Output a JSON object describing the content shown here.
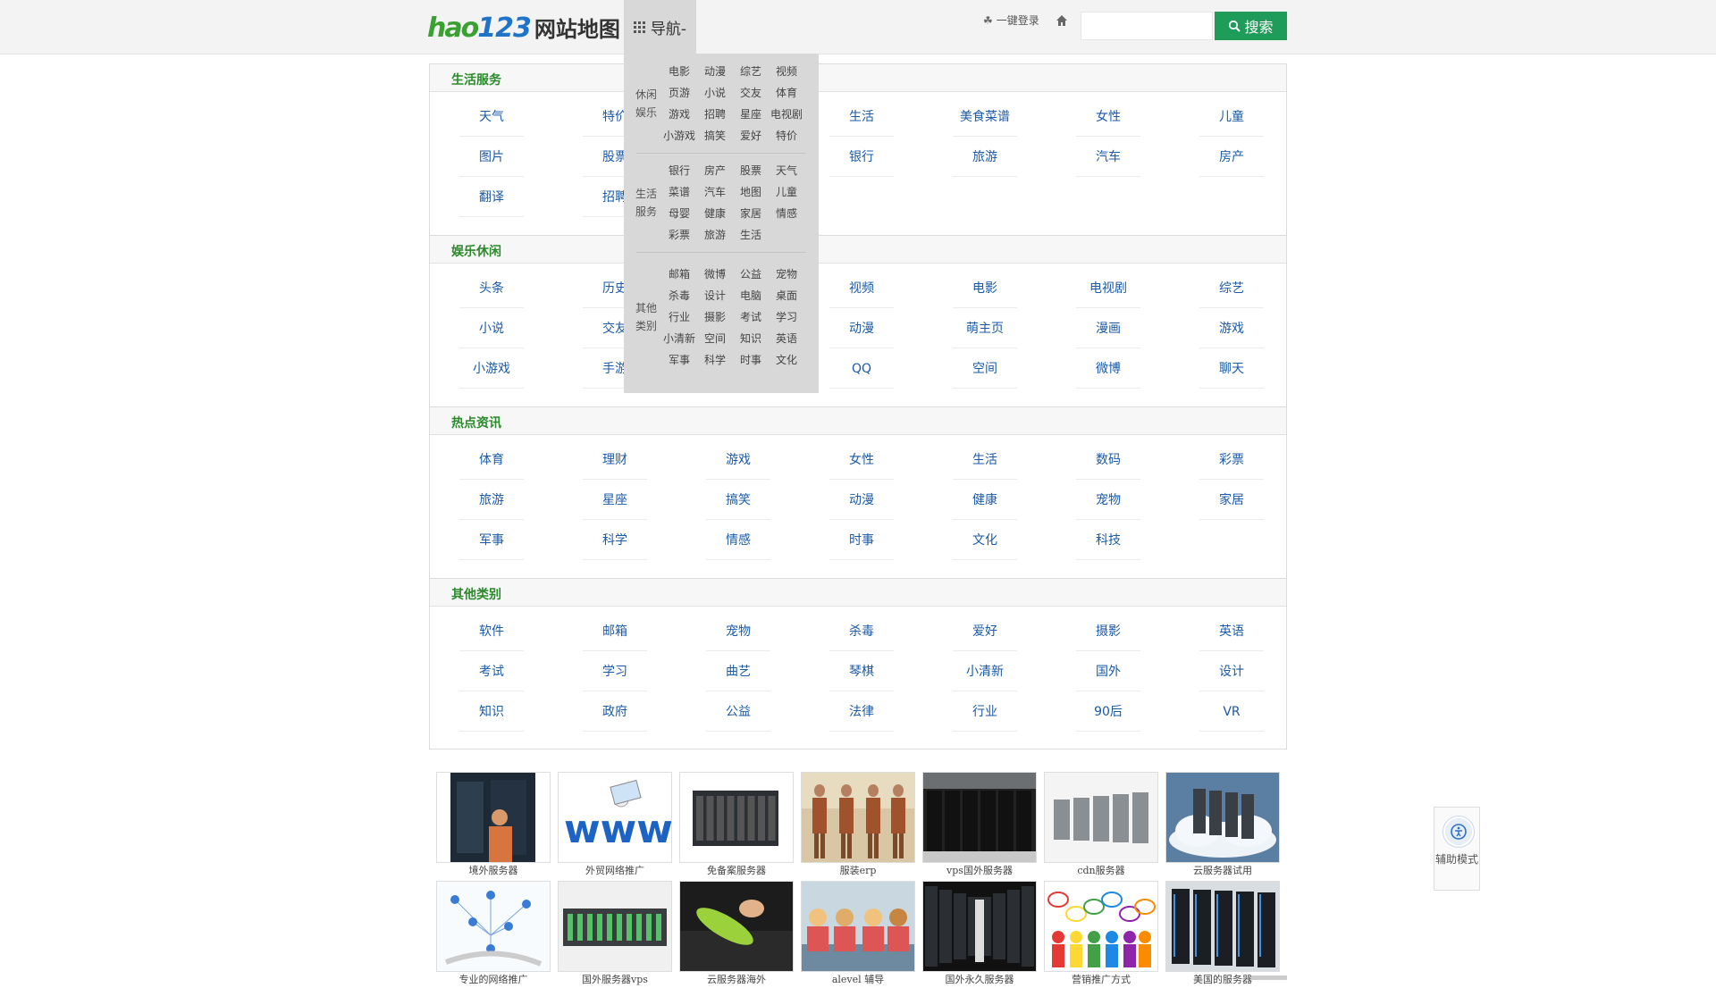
{
  "header": {
    "logo_hao": "hao",
    "logo_123": "123",
    "logo_title": "网站地图",
    "nav_label": "导航-",
    "login_label": "一键登录",
    "search_placeholder": "",
    "search_button": "搜索"
  },
  "nav_dropdown": [
    {
      "category": "休闲娱乐",
      "links": [
        "电影",
        "动漫",
        "综艺",
        "视频",
        "页游",
        "小说",
        "交友",
        "体育",
        "游戏",
        "招聘",
        "星座",
        "电视剧",
        "小游戏",
        "搞笑",
        "爱好",
        "特价"
      ]
    },
    {
      "category": "生活服务",
      "links": [
        "银行",
        "房产",
        "股票",
        "天气",
        "菜谱",
        "汽车",
        "地图",
        "儿童",
        "母婴",
        "健康",
        "家居",
        "情感",
        "彩票",
        "旅游",
        "生活"
      ]
    },
    {
      "category": "其他类别",
      "links": [
        "邮箱",
        "微博",
        "公益",
        "宠物",
        "杀毒",
        "设计",
        "电脑",
        "桌面",
        "行业",
        "摄影",
        "考试",
        "学习",
        "小清新",
        "空间",
        "知识",
        "英语",
        "军事",
        "科学",
        "时事",
        "文化"
      ]
    }
  ],
  "sections": [
    {
      "title": "生活服务",
      "links": [
        "天气",
        "特价",
        "",
        "生活",
        "美食菜谱",
        "女性",
        "儿童",
        "图片",
        "股票",
        "",
        "银行",
        "旅游",
        "汽车",
        "房产",
        "翻译",
        "招聘",
        "",
        "",
        "",
        "",
        ""
      ]
    },
    {
      "title": "娱乐休闲",
      "links": [
        "头条",
        "历史",
        "",
        "视频",
        "电影",
        "电视剧",
        "综艺",
        "小说",
        "交友",
        "",
        "动漫",
        "萌主页",
        "漫画",
        "游戏",
        "小游戏",
        "手游",
        "",
        "QQ",
        "空间",
        "微博",
        "聊天"
      ]
    },
    {
      "title": "热点资讯",
      "links": [
        "体育",
        "理财",
        "游戏",
        "女性",
        "生活",
        "数码",
        "彩票",
        "旅游",
        "星座",
        "搞笑",
        "动漫",
        "健康",
        "宠物",
        "家居",
        "军事",
        "科学",
        "情感",
        "时事",
        "文化",
        "科技",
        ""
      ]
    },
    {
      "title": "其他类别",
      "links": [
        "软件",
        "邮箱",
        "宠物",
        "杀毒",
        "爱好",
        "摄影",
        "英语",
        "考试",
        "学习",
        "曲艺",
        "琴棋",
        "小清新",
        "国外",
        "设计",
        "知识",
        "政府",
        "公益",
        "法律",
        "行业",
        "90后",
        "VR"
      ]
    }
  ],
  "thumbnails": [
    {
      "caption": "境外服务器",
      "kind": "server-tech"
    },
    {
      "caption": "外贸网络推广",
      "kind": "www"
    },
    {
      "caption": "免备案服务器",
      "kind": "blade"
    },
    {
      "caption": "服装erp",
      "kind": "fashion"
    },
    {
      "caption": "vps国外服务器",
      "kind": "datacenter"
    },
    {
      "caption": "cdn服务器",
      "kind": "racks-white"
    },
    {
      "caption": "云服务器试用",
      "kind": "cloud"
    },
    {
      "caption": "专业的网络推广",
      "kind": "network"
    },
    {
      "caption": "国外服务器vps",
      "kind": "rack-unit"
    },
    {
      "caption": "云服务器海外",
      "kind": "cleaning"
    },
    {
      "caption": "alevel 辅导",
      "kind": "students"
    },
    {
      "caption": "国外永久服务器",
      "kind": "aisle"
    },
    {
      "caption": "营销推广方式",
      "kind": "people"
    },
    {
      "caption": "美国的服务器",
      "kind": "dark-racks"
    }
  ],
  "helper": {
    "label": "辅助模式"
  },
  "colors": {
    "accent_green": "#1f9b5a",
    "section_title": "#2b8a2b",
    "link_blue": "#1a5aa8",
    "logo_green": "#3aa031",
    "logo_blue": "#1f73c9"
  }
}
